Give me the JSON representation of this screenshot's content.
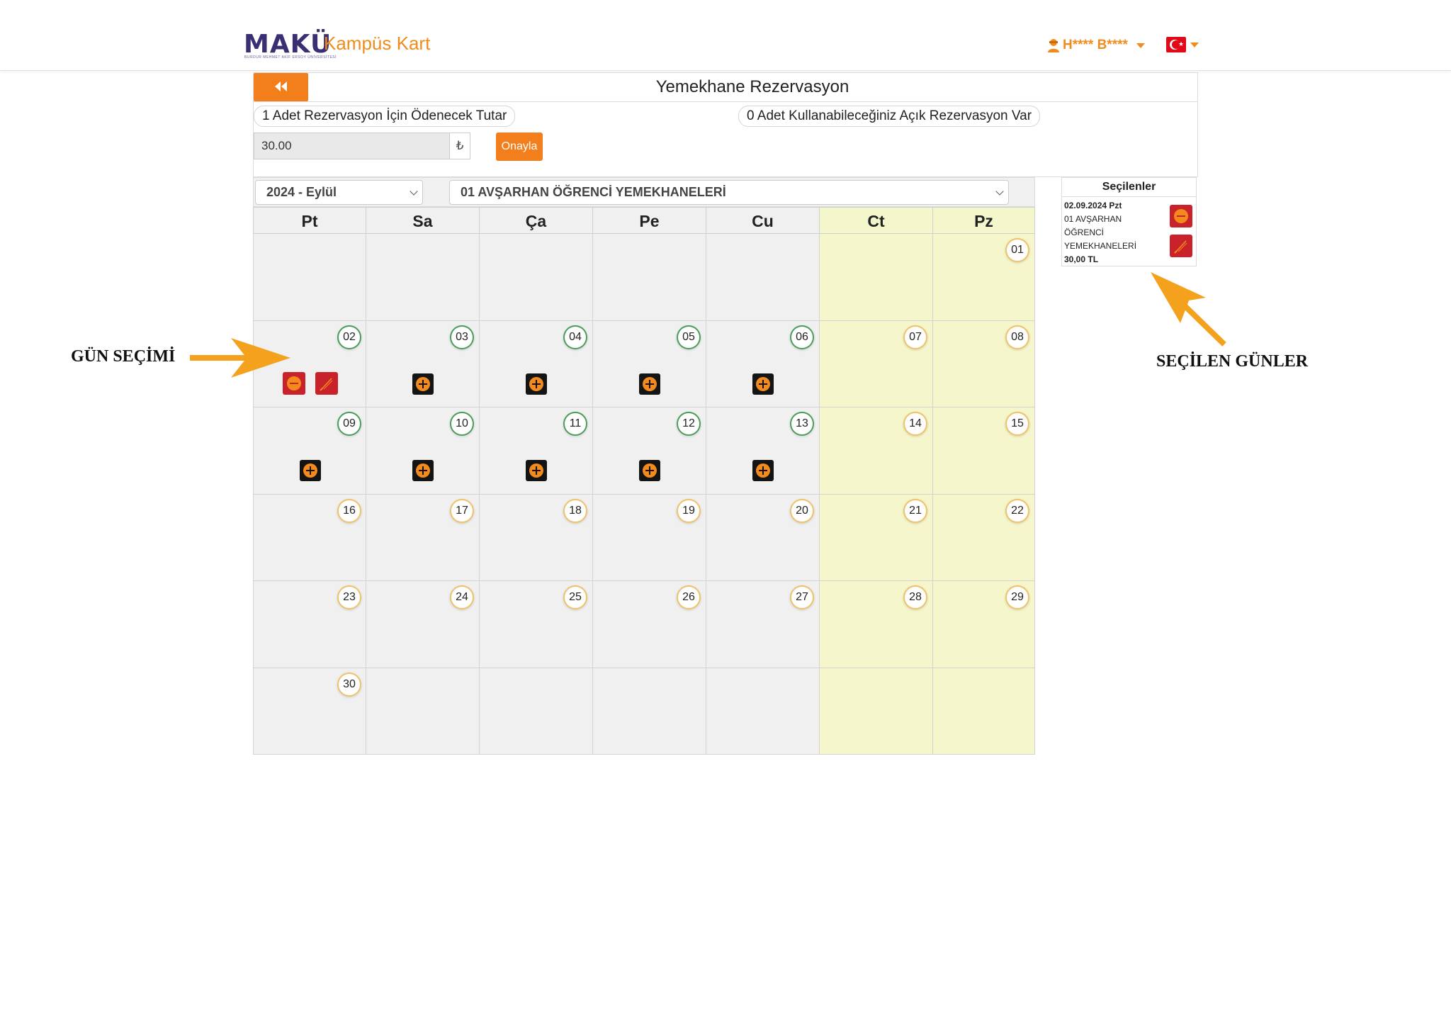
{
  "header": {
    "brand_main": "MAKÜ",
    "brand_sub": "BURDUR MEHMET AKİF ERSOY ÜNİVERSİTESİ",
    "brand_product": "Kampüs Kart",
    "user_name": "H**** B****",
    "language_flag": "turkey-flag"
  },
  "panel": {
    "back_icon": "double-chevron-left-icon",
    "title": "Yemekhane Rezervasyon",
    "price_label": "1 Adet Rezervasyon İçin Ödenecek Tutar",
    "open_reservations_label": "0 Adet Kullanabileceğiniz Açık Rezervasyon Var",
    "amount_value": "30.00",
    "currency_symbol": "₺",
    "confirm_label": "Onayla"
  },
  "calendar": {
    "month_select": "2024 - Eylül",
    "location_select": "01 AVŞARHAN ÖĞRENCİ YEMEKHANELERİ",
    "weekdays": [
      "Pt",
      "Sa",
      "Ça",
      "Pe",
      "Cu",
      "Ct",
      "Pz"
    ],
    "weeks": [
      [
        null,
        null,
        null,
        null,
        null,
        null,
        "01"
      ],
      [
        "02",
        "03",
        "04",
        "05",
        "06",
        "07",
        "08"
      ],
      [
        "09",
        "10",
        "11",
        "12",
        "13",
        "14",
        "15"
      ],
      [
        "16",
        "17",
        "18",
        "19",
        "20",
        "21",
        "22"
      ],
      [
        "23",
        "24",
        "25",
        "26",
        "27",
        "28",
        "29"
      ],
      [
        "30",
        null,
        null,
        null,
        null,
        null,
        null
      ]
    ],
    "available_days": [
      "02",
      "03",
      "04",
      "05",
      "06",
      "09",
      "10",
      "11",
      "12",
      "13"
    ],
    "selected_days": [
      "02"
    ],
    "colors": {
      "accent": "#f27e1c",
      "weekend": "#f5f6cc",
      "available_border": "#4a9e5c",
      "unavailable_border": "#f0c36b",
      "remove_button": "#c9222a"
    }
  },
  "selected": {
    "title": "Seçilenler",
    "date": "02.09.2024 Pzt",
    "location_line1": "01 AVŞARHAN",
    "location_line2": "ÖĞRENCİ",
    "location_line3": "YEMEKHANELERİ",
    "price": "30,00 TL"
  },
  "annotations": {
    "left": "GÜN SEÇİMİ",
    "right": "SEÇİLEN GÜNLER"
  }
}
